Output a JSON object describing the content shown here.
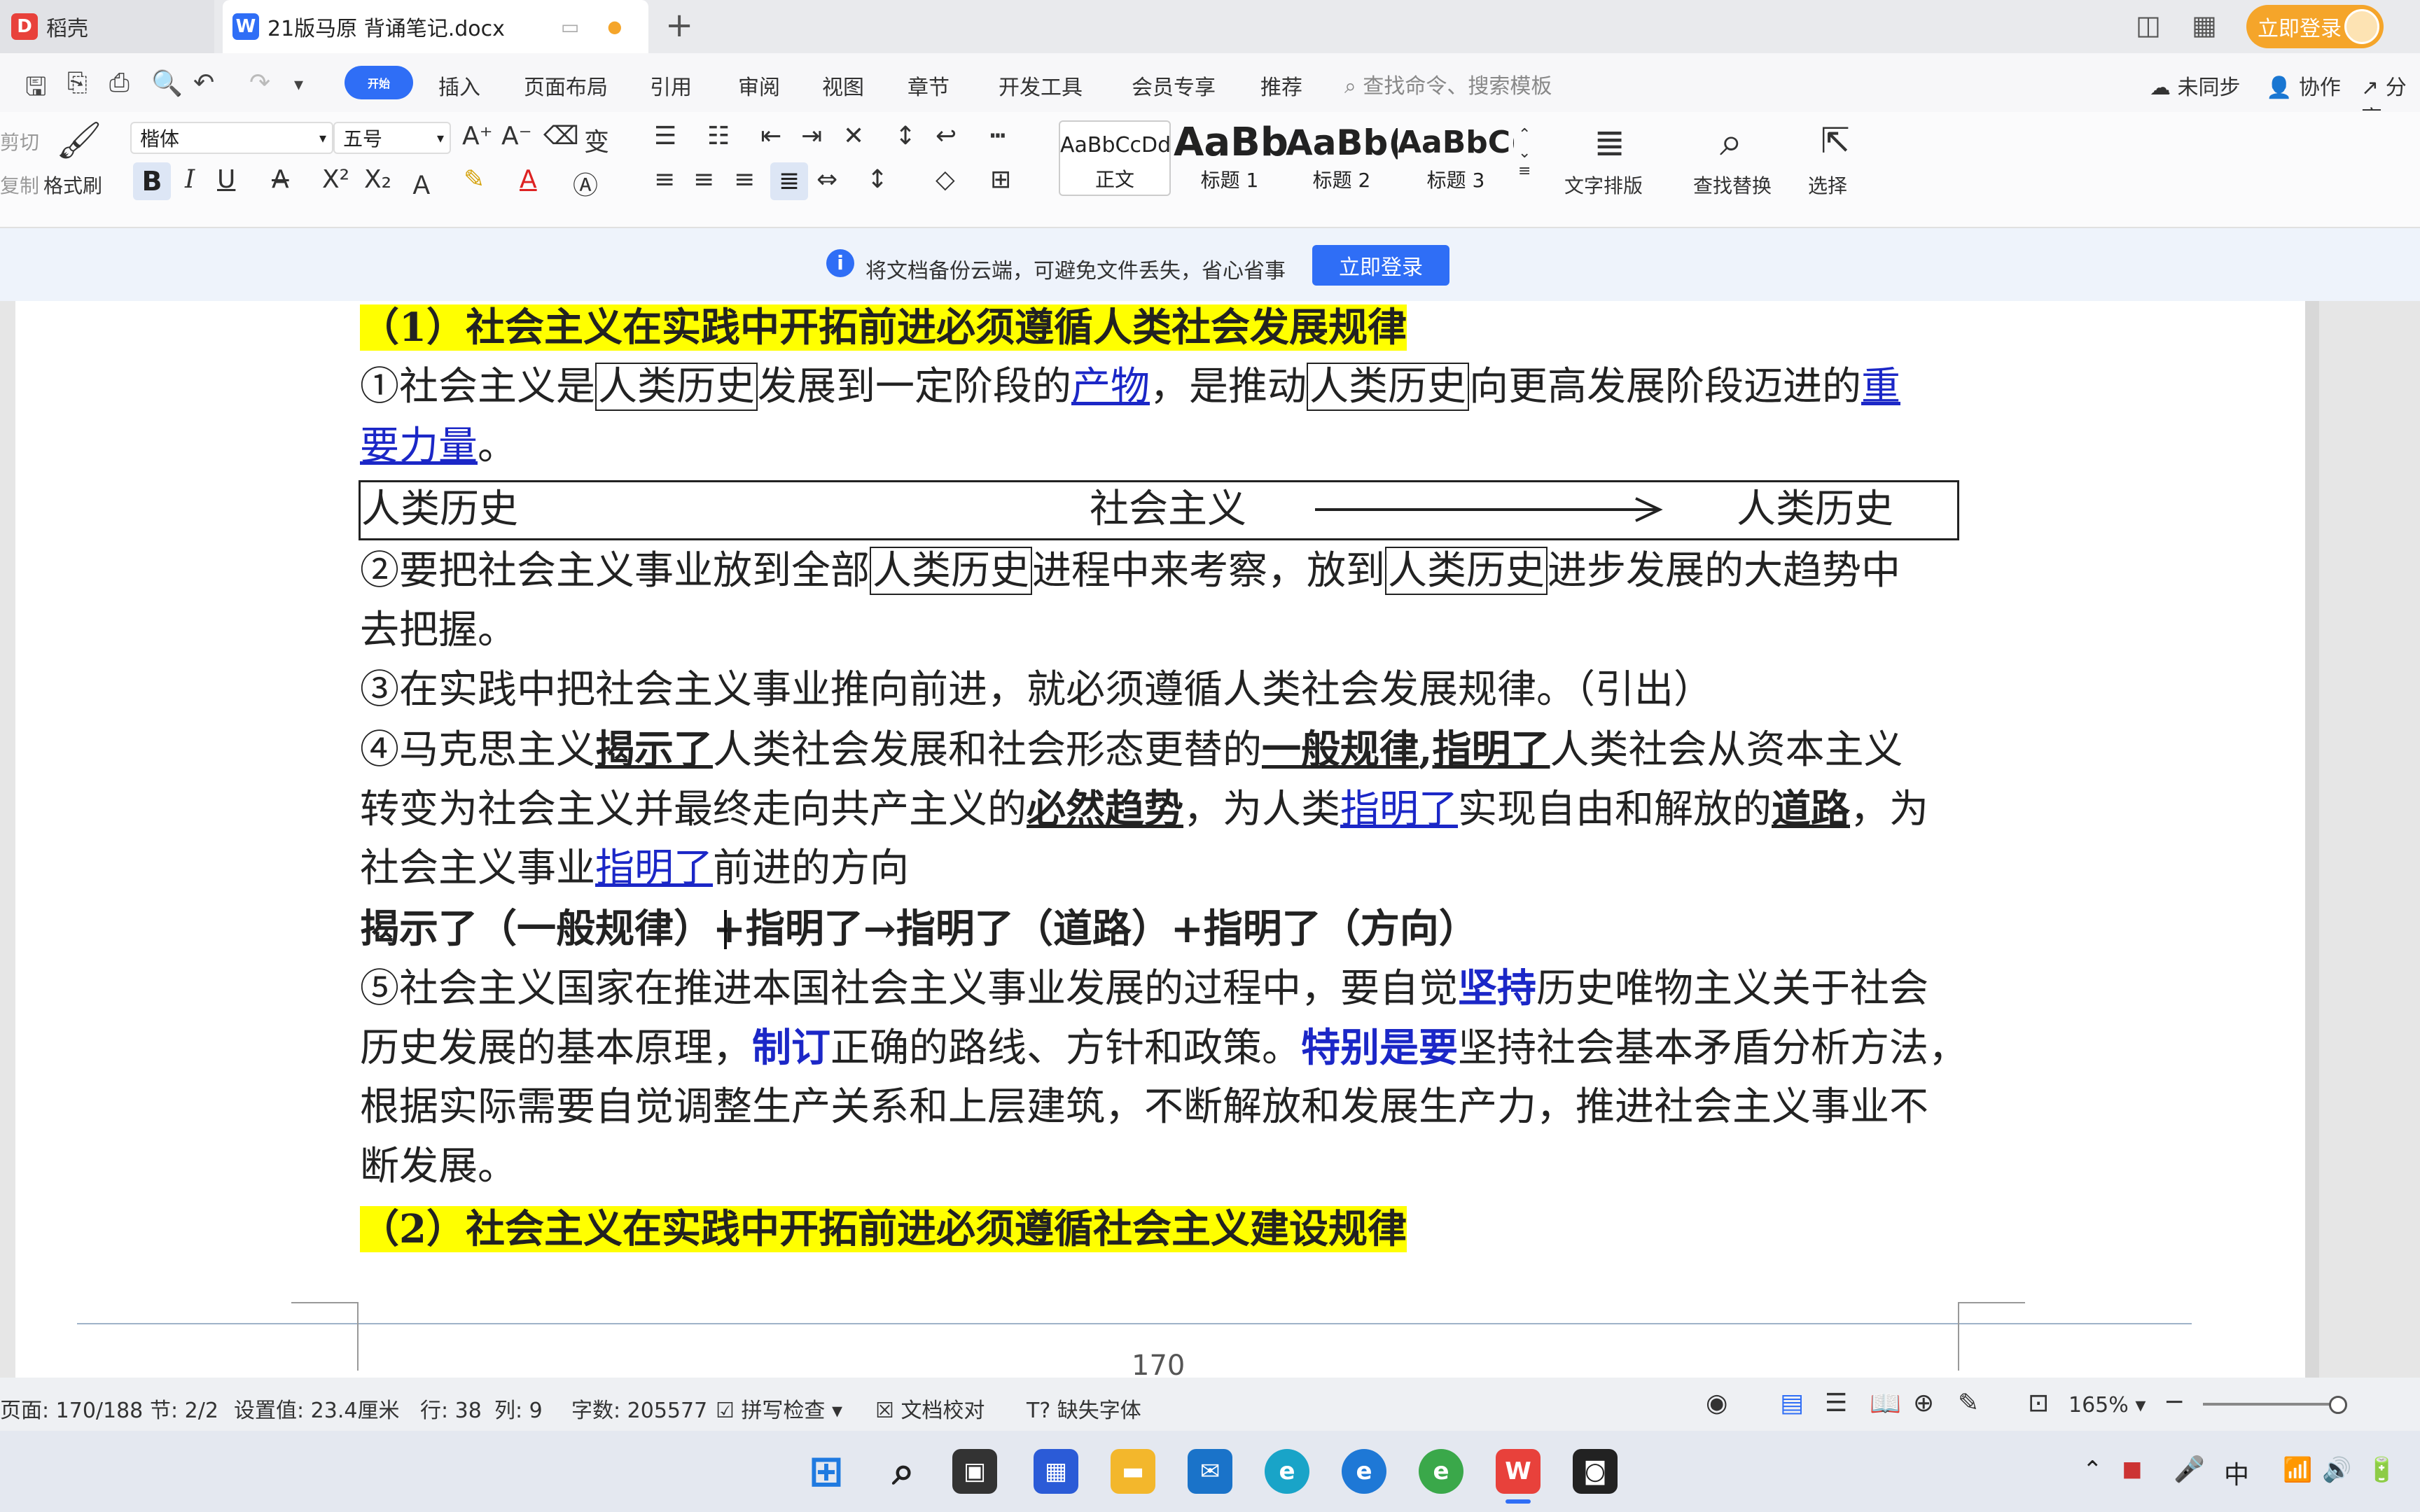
{
  "tabs": {
    "daoke": "稻壳",
    "doc": "21版马原 背诵笔记.docx",
    "login": "立即登录"
  },
  "menu": {
    "items": [
      "开始",
      "插入",
      "页面布局",
      "引用",
      "审阅",
      "视图",
      "章节",
      "开发工具",
      "会员专享",
      "推荐"
    ],
    "search_placeholder": "查找命令、搜索模板",
    "unsynced": "未同步",
    "collab": "协作",
    "share": "分享"
  },
  "ribbon": {
    "cut": "剪切",
    "copy": "复制",
    "format_painter": "格式刷",
    "font": "楷体",
    "size": "五号",
    "styles": [
      {
        "preview": "AaBbCcDd",
        "label": "正文"
      },
      {
        "preview": "AaBb",
        "label": "标题 1"
      },
      {
        "preview": "AaBb(",
        "label": "标题 2"
      },
      {
        "preview": "AaBbC(",
        "label": "标题 3"
      }
    ],
    "text_layout": "文字排版",
    "find_replace": "查找替换",
    "select": "选择"
  },
  "notice": {
    "text": "将文档备份云端，可避免文件丢失，省心省事",
    "button": "立即登录"
  },
  "doc": {
    "h1": "（1）社会主义在实践中开拓前进必须遵循人类社会发展规律",
    "p1": {
      "a": "①社会主义是",
      "b": "人类历史",
      "c": "发展到一定阶段的",
      "d": "产物",
      "e": "，是推动",
      "f": "人类历史",
      "g": "向更高发展阶段迈进的",
      "h": "重",
      "i": "要力量",
      "j": "。"
    },
    "diagram": {
      "left": "人类历史",
      "mid": "社会主义",
      "right": "人类历史"
    },
    "p2": {
      "a": "②要把社会主义事业放到全部",
      "b": "人类历史",
      "c": "进程中来考察，放到",
      "d": "人类历史",
      "e": "进步发展的大趋势中",
      "f": "去把握。"
    },
    "p3": "③在实践中把社会主义事业推向前进，就必须遵循人类社会发展规律。（引出）",
    "p4": {
      "a": "④马克思主义",
      "b": "揭示了",
      "c": "人类社会发展和社会形态更替的",
      "d": "一般规律",
      "e": ",",
      "f": "指明了",
      "g": "人类社会从资本主义",
      "h": "转变为社会主义并最终走向共产主义的",
      "i": "必然趋势",
      "j": "，为人类",
      "k": "指明了",
      "l": "实现自由和解放的",
      "m": "道路",
      "n": "，为",
      "o": "社会主义事业",
      "p": "指明了",
      "q": "前进的方向"
    },
    "summary": "揭示了（一般规律）+指明了→指明了（道路）+指明了（方向）",
    "p5": {
      "a": "⑤社会主义国家在推进本国社会主义事业发展的过程中，要自觉",
      "b": "坚持",
      "c": "历史唯物主义关于社会",
      "d": "历史发展的基本原理，",
      "e": "制订",
      "f": "正确的路线、方针和政策。",
      "g": "特别是要",
      "h": "坚持社会基本矛盾分析方法，",
      "i": "根据实际需要自觉调整生产关系和上层建筑，不断解放和发展生产力，推进社会主义事业不",
      "j": "断发展。"
    },
    "h2": "（2）社会主义在实践中开拓前进必须遵循社会主义建设规律",
    "page_number": "170"
  },
  "status": {
    "page": "页面: 170/188",
    "section": "节: 2/2",
    "setting": "设置值: 23.4厘米",
    "row": "行: 38",
    "col": "列: 9",
    "words": "字数: 205577",
    "spell": "拼写检查",
    "proof": "文档校对",
    "missing_font": "缺失字体",
    "zoom": "165%"
  },
  "tray": {
    "ime": "中"
  }
}
